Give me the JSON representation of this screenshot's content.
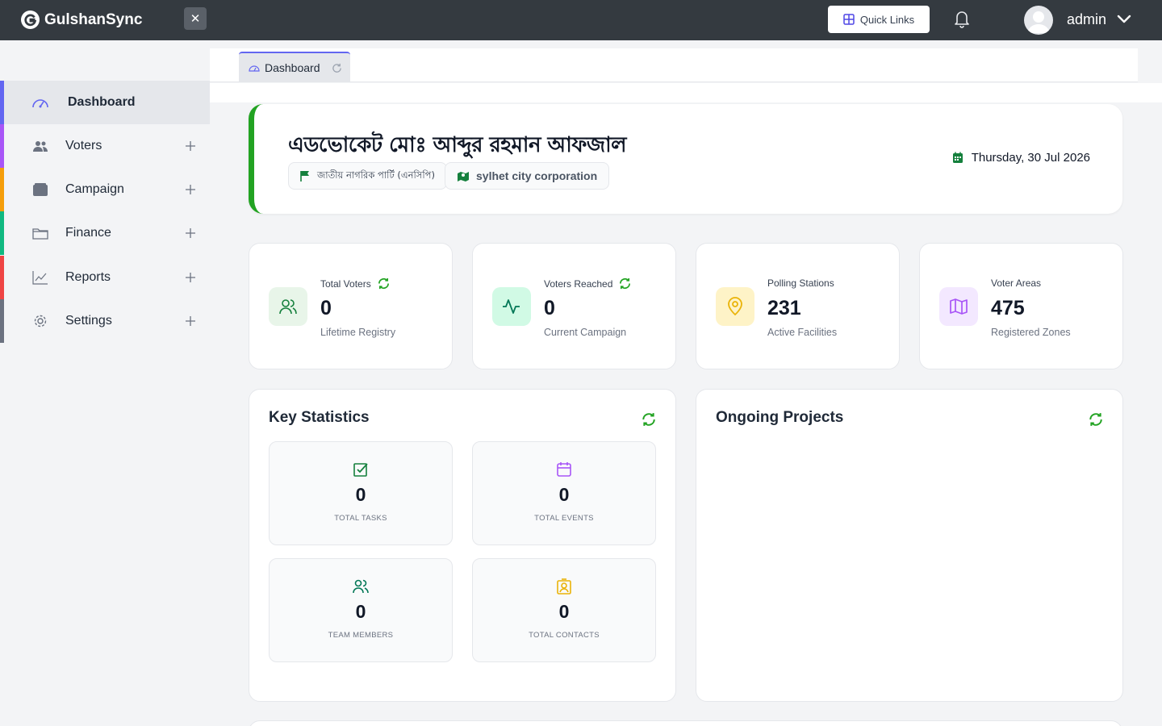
{
  "topbar": {
    "brand": "GulshanSync",
    "close_symbol": "✕",
    "quick_links_label": "Quick Links",
    "user_name": "admin"
  },
  "sidebar": {
    "items": [
      {
        "label": "Dashboard",
        "icon": "gauge-icon",
        "accent": "#6366f1",
        "active": true
      },
      {
        "label": "Voters",
        "icon": "users-icon",
        "accent": "#a855f7"
      },
      {
        "label": "Campaign",
        "icon": "wallet-icon",
        "accent": "#f59e0b"
      },
      {
        "label": "Finance",
        "icon": "folder-icon",
        "accent": "#10b981"
      },
      {
        "label": "Reports",
        "icon": "chart-line-icon",
        "accent": "#ef4444"
      },
      {
        "label": "Settings",
        "icon": "gear-icon",
        "accent": "#6b7280"
      }
    ]
  },
  "tab": {
    "label": "Dashboard"
  },
  "header": {
    "title": "এডভোকেট মোঃ আব্দুর রহমান আফজাল",
    "party": "জাতীয় নাগরিক পার্টি (এনসিপি)",
    "location": "sylhet city corporation",
    "date": "Thursday, 30 Jul 2026",
    "accent": "#22a322"
  },
  "stats": [
    {
      "label": "Total Voters",
      "value": "0",
      "sub": "Lifetime Registry",
      "icon": "users-icon",
      "bg": "#e8f5e9",
      "color": "#15803d"
    },
    {
      "label": "Voters Reached",
      "value": "0",
      "sub": "Current Campaign",
      "icon": "activity-icon",
      "bg": "#d1fae5",
      "color": "#047857"
    },
    {
      "label": "Polling Stations",
      "value": "231",
      "sub": "Active Facilities",
      "icon": "map-pin-icon",
      "bg": "#fef3c7",
      "color": "#eab308"
    },
    {
      "label": "Voter Areas",
      "value": "475",
      "sub": "Registered Zones",
      "icon": "map-icon",
      "bg": "#f3e8ff",
      "color": "#a855f7"
    }
  ],
  "key_statistics": {
    "title": "Key Statistics",
    "items": [
      {
        "value": "0",
        "label": "TOTAL TASKS",
        "icon": "check-square-icon",
        "color": "#15803d"
      },
      {
        "value": "0",
        "label": "TOTAL EVENTS",
        "icon": "calendar-icon",
        "color": "#a855f7"
      },
      {
        "value": "0",
        "label": "TEAM MEMBERS",
        "icon": "users-icon",
        "color": "#047857"
      },
      {
        "value": "0",
        "label": "TOTAL CONTACTS",
        "icon": "contact-icon",
        "color": "#eab308"
      }
    ]
  },
  "ongoing_projects": {
    "title": "Ongoing Projects"
  }
}
